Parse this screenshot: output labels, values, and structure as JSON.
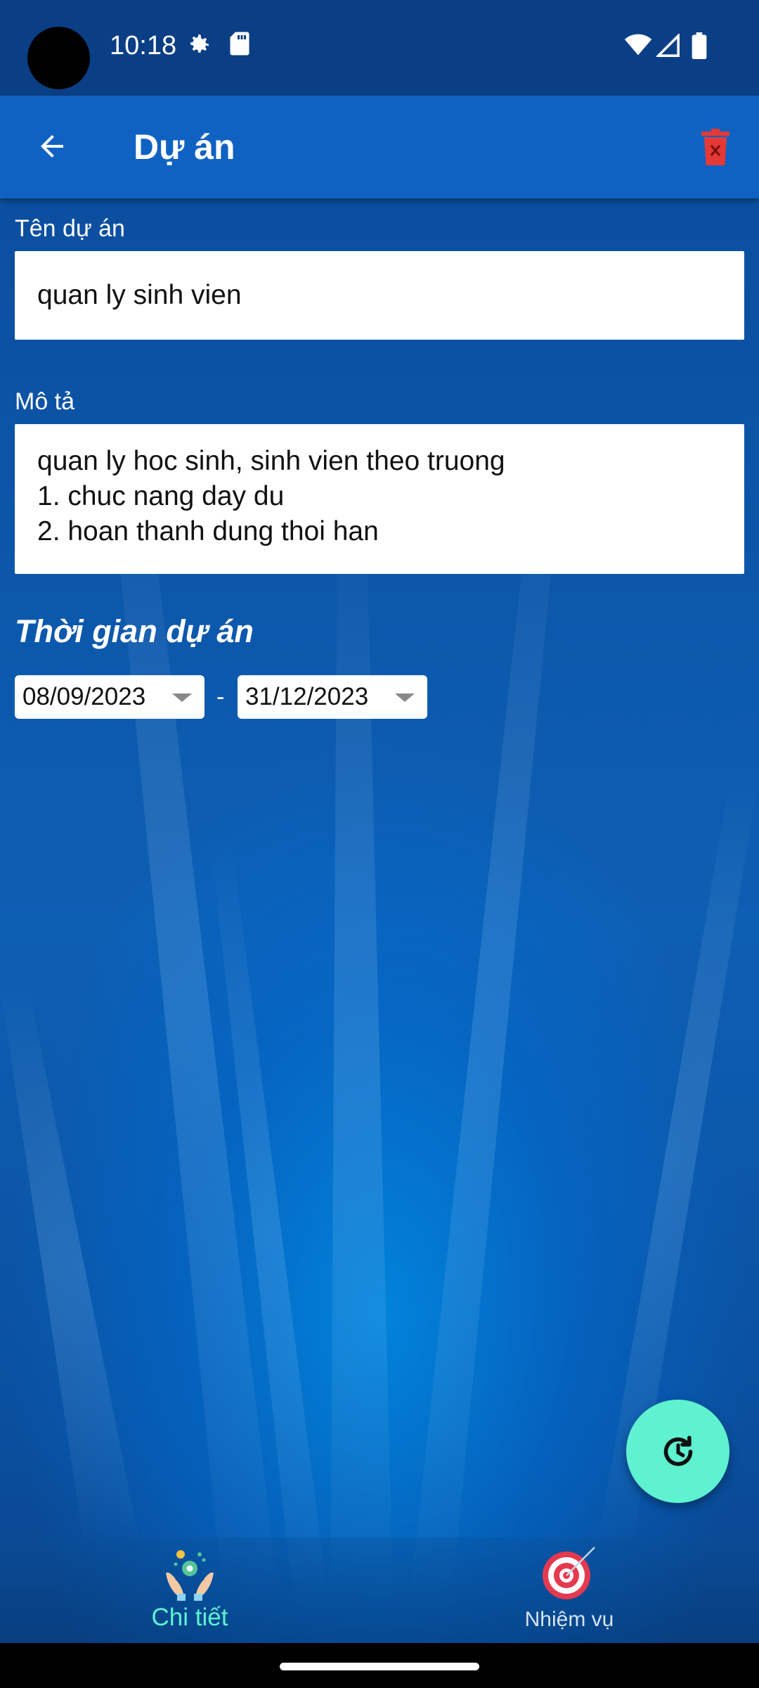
{
  "status_bar": {
    "time": "10:18"
  },
  "app_bar": {
    "title": "Dự án"
  },
  "form": {
    "name_label": "Tên dự án",
    "name_value": "quan ly sinh vien",
    "desc_label": "Mô tả",
    "desc_value": "quan ly hoc sinh, sinh vien theo truong\n1. chuc nang day du\n2. hoan thanh dung thoi han",
    "period_title": "Thời gian dự án",
    "start_date": "08/09/2023",
    "separator": "-",
    "end_date": "31/12/2023"
  },
  "bottom_nav": {
    "items": [
      {
        "label": "Chi tiết",
        "icon": "hands-gear-icon",
        "active": true
      },
      {
        "label": "Nhiệm vụ",
        "icon": "target-icon",
        "active": false
      }
    ]
  },
  "fab": {
    "icon": "history-icon"
  },
  "colors": {
    "app_bar": "#1062c2",
    "accent": "#5ef2d0",
    "delete": "#e53935",
    "background": "#0b4a9a"
  }
}
